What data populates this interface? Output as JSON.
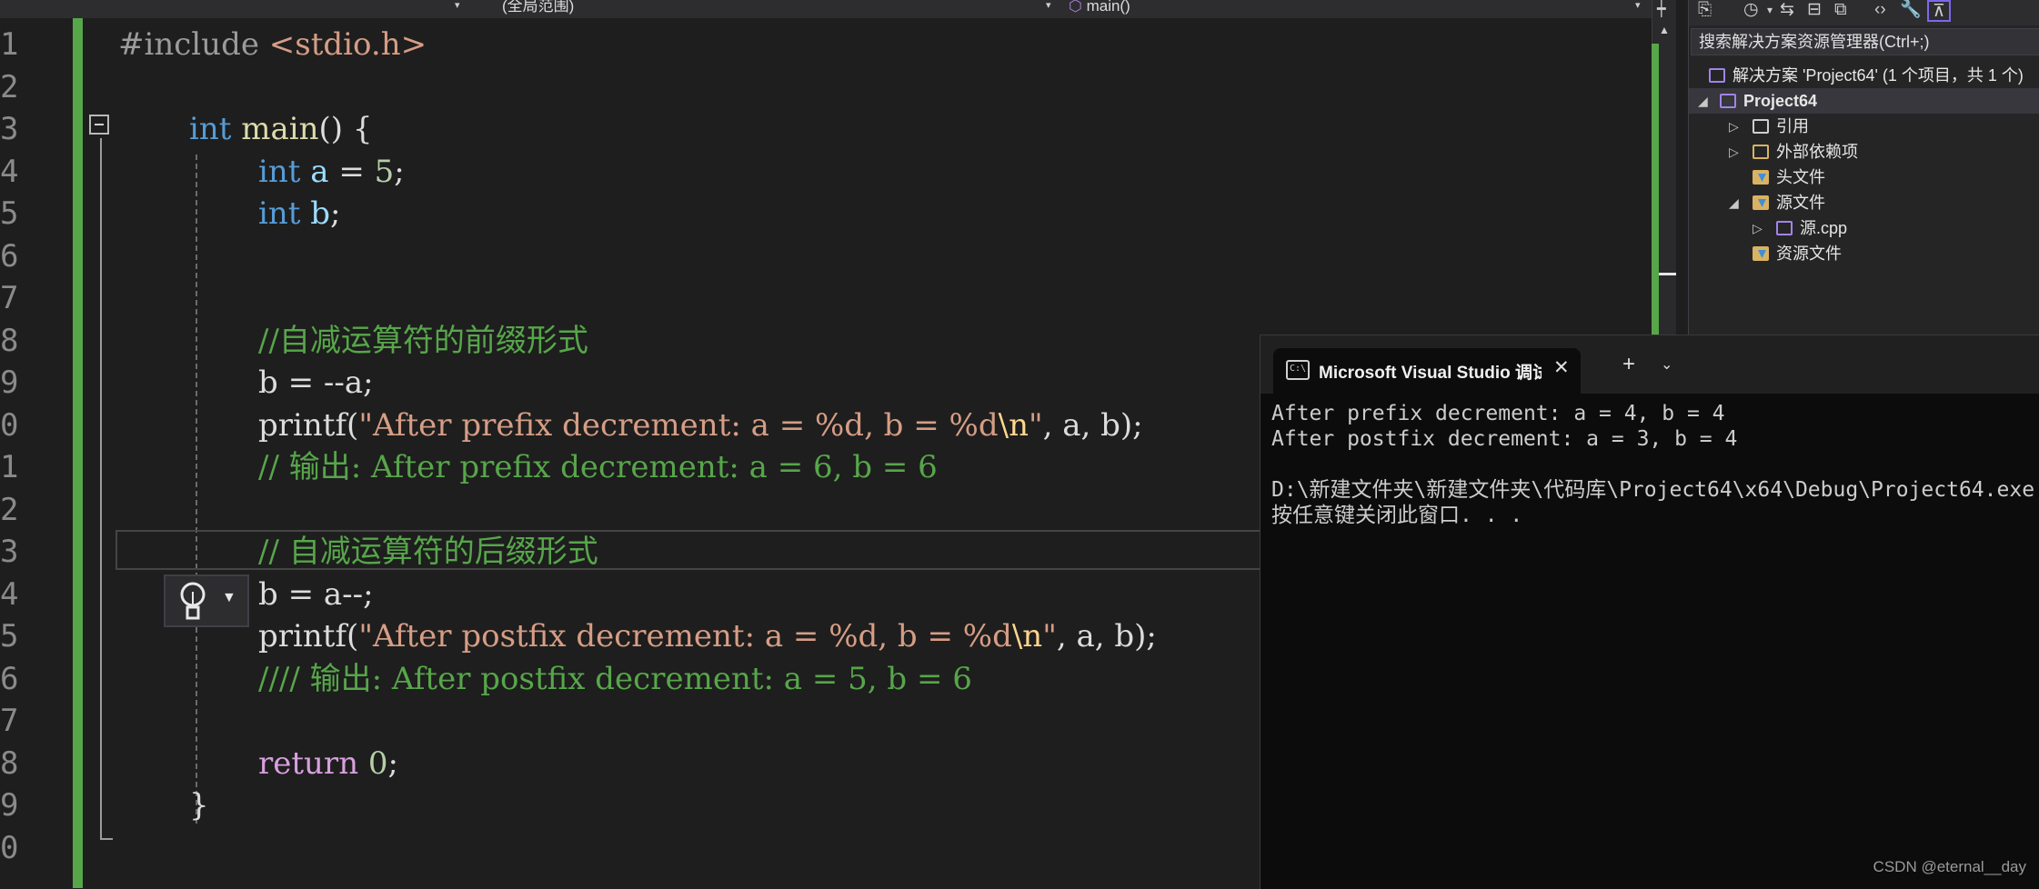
{
  "nav_bar": {
    "scope": "(全局范围)",
    "member": "main()"
  },
  "editor": {
    "line_numbers": [
      "1",
      "2",
      "3",
      "4",
      "5",
      "6",
      "7",
      "8",
      "9",
      "0",
      "1",
      "2",
      "3",
      "4",
      "5",
      "6",
      "7",
      "8",
      "9",
      "0"
    ],
    "lines": [
      [
        {
          "t": "#include ",
          "c": "pre"
        },
        {
          "t": "<stdio.h>",
          "c": "str"
        }
      ],
      [],
      [
        {
          "t": "int",
          "c": "kw"
        },
        {
          "t": " ",
          "c": "def"
        },
        {
          "t": "main",
          "c": "fn"
        },
        {
          "t": "() {",
          "c": "def"
        }
      ],
      [
        {
          "t": "int",
          "c": "kw"
        },
        {
          "t": " ",
          "c": "def"
        },
        {
          "t": "a",
          "c": "var"
        },
        {
          "t": " = ",
          "c": "def"
        },
        {
          "t": "5",
          "c": "num"
        },
        {
          "t": ";",
          "c": "def"
        }
      ],
      [
        {
          "t": "int",
          "c": "kw"
        },
        {
          "t": " ",
          "c": "def"
        },
        {
          "t": "b",
          "c": "var"
        },
        {
          "t": ";",
          "c": "def"
        }
      ],
      [],
      [],
      [
        {
          "t": "//自减运算符的前缀形式",
          "c": "cmt"
        }
      ],
      [
        {
          "t": "b = --a;",
          "c": "def"
        }
      ],
      [
        {
          "t": "printf",
          "c": "def"
        },
        {
          "t": "(",
          "c": "def"
        },
        {
          "t": "\"After prefix decrement: a = %d, b = %d",
          "c": "str"
        },
        {
          "t": "\\n",
          "c": "esc"
        },
        {
          "t": "\"",
          "c": "str"
        },
        {
          "t": ", a, b);",
          "c": "def"
        }
      ],
      [
        {
          "t": "// 输出: After prefix decrement: a = 6, b = 6",
          "c": "cmt"
        }
      ],
      [],
      [
        {
          "t": "// 自减运算符的后缀形式",
          "c": "cmt"
        }
      ],
      [
        {
          "t": "b = a--;",
          "c": "def"
        }
      ],
      [
        {
          "t": "printf",
          "c": "def"
        },
        {
          "t": "(",
          "c": "def"
        },
        {
          "t": "\"After postfix decrement: a = %d, b = %d",
          "c": "str"
        },
        {
          "t": "\\n",
          "c": "esc"
        },
        {
          "t": "\"",
          "c": "str"
        },
        {
          "t": ", a, b);",
          "c": "def"
        }
      ],
      [
        {
          "t": "//// 输出: After postfix decrement: a = 5, b = 6",
          "c": "cmt"
        }
      ],
      [],
      [
        {
          "t": "return",
          "c": "ret"
        },
        {
          "t": " ",
          "c": "def"
        },
        {
          "t": "0",
          "c": "num"
        },
        {
          "t": ";",
          "c": "def"
        }
      ],
      [
        {
          "t": "}",
          "c": "def"
        }
      ],
      []
    ]
  },
  "solution_explorer": {
    "search_placeholder": "搜索解决方案资源管理器(Ctrl+;)",
    "items": [
      {
        "label": "解决方案 'Project64' (1 个项目，共 1 个)",
        "icon": "solution-icon",
        "caret": "",
        "bold": false
      },
      {
        "label": "Project64",
        "icon": "project-icon",
        "caret": "◢",
        "bold": true
      },
      {
        "label": "引用",
        "icon": "references-icon",
        "caret": "▷",
        "bold": false
      },
      {
        "label": "外部依赖项",
        "icon": "external-deps-icon",
        "caret": "▷",
        "bold": false
      },
      {
        "label": "头文件",
        "icon": "folder-icon",
        "caret": "",
        "bold": false
      },
      {
        "label": "源文件",
        "icon": "folder-icon",
        "caret": "◢",
        "bold": false
      },
      {
        "label": "源.cpp",
        "icon": "cpp-file-icon",
        "caret": "▷",
        "bold": false
      },
      {
        "label": "资源文件",
        "icon": "folder-icon",
        "caret": "",
        "bold": false
      }
    ]
  },
  "console": {
    "tab_title": "Microsoft Visual Studio 调试控制台",
    "lines": [
      "After prefix decrement: a = 4, b = 4",
      "After postfix decrement: a = 3, b = 4",
      "",
      "D:\\新建文件夹\\新建文件夹\\代码库\\Project64\\x64\\Debug\\Project64.exe",
      "按任意键关闭此窗口. . ."
    ]
  },
  "watermark": "CSDN @eternal__day",
  "colors": {
    "kw": "#569cd6",
    "fn": "#dcdcaa",
    "var": "#9cdcfe",
    "num": "#b5cea8",
    "str": "#d69d85",
    "esc": "#ffd68f",
    "cmt": "#57a64a",
    "pre": "#9b9b9b",
    "ret": "#d8a0df",
    "def": "#dcdcdc",
    "change_bar": "#57a64a"
  }
}
